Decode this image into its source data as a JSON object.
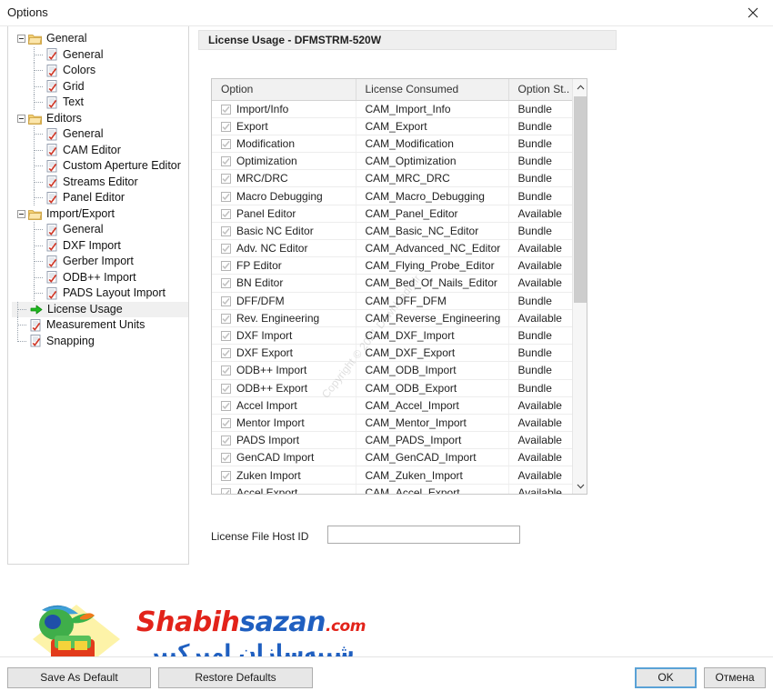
{
  "window": {
    "title": "Options",
    "close_icon": "close-icon",
    "close_glyph": "✕"
  },
  "tree": {
    "nodes": [
      {
        "label": "General",
        "level": 0,
        "icon": "folder-icon",
        "expanded": true,
        "selected": false
      },
      {
        "label": "General",
        "level": 1,
        "icon": "page-edit-icon",
        "expanded": false,
        "selected": false
      },
      {
        "label": "Colors",
        "level": 1,
        "icon": "page-edit-icon",
        "expanded": false,
        "selected": false
      },
      {
        "label": "Grid",
        "level": 1,
        "icon": "page-edit-icon",
        "expanded": false,
        "selected": false
      },
      {
        "label": "Text",
        "level": 1,
        "icon": "page-edit-icon",
        "expanded": false,
        "selected": false
      },
      {
        "label": "Editors",
        "level": 0,
        "icon": "folder-icon",
        "expanded": true,
        "selected": false
      },
      {
        "label": "General",
        "level": 1,
        "icon": "page-edit-icon",
        "expanded": false,
        "selected": false
      },
      {
        "label": "CAM Editor",
        "level": 1,
        "icon": "page-edit-icon",
        "expanded": false,
        "selected": false
      },
      {
        "label": "Custom Aperture Editor",
        "level": 1,
        "icon": "page-edit-icon",
        "expanded": false,
        "selected": false
      },
      {
        "label": "Streams Editor",
        "level": 1,
        "icon": "page-edit-icon",
        "expanded": false,
        "selected": false
      },
      {
        "label": "Panel Editor",
        "level": 1,
        "icon": "page-edit-icon",
        "expanded": false,
        "selected": false
      },
      {
        "label": "Import/Export",
        "level": 0,
        "icon": "folder-icon",
        "expanded": true,
        "selected": false
      },
      {
        "label": "General",
        "level": 1,
        "icon": "page-edit-icon",
        "expanded": false,
        "selected": false
      },
      {
        "label": "DXF Import",
        "level": 1,
        "icon": "page-edit-icon",
        "expanded": false,
        "selected": false
      },
      {
        "label": "Gerber Import",
        "level": 1,
        "icon": "page-edit-icon",
        "expanded": false,
        "selected": false
      },
      {
        "label": "ODB++ Import",
        "level": 1,
        "icon": "page-edit-icon",
        "expanded": false,
        "selected": false
      },
      {
        "label": "PADS Layout Import",
        "level": 1,
        "icon": "page-edit-icon",
        "expanded": false,
        "selected": false
      },
      {
        "label": "License Usage",
        "level": 0,
        "icon": "green-arrow-icon",
        "expanded": false,
        "selected": true
      },
      {
        "label": "Measurement Units",
        "level": 0,
        "icon": "page-edit-icon",
        "expanded": false,
        "selected": false
      },
      {
        "label": "Snapping",
        "level": 0,
        "icon": "page-edit-icon",
        "expanded": false,
        "selected": false
      }
    ]
  },
  "content": {
    "section_title": "License Usage - DFMSTRM-520W",
    "table": {
      "columns": [
        "Option",
        "License Consumed",
        "Option St.."
      ],
      "rows": [
        {
          "checked": true,
          "option": "Import/Info",
          "license": "CAM_Import_Info",
          "status": "Bundle"
        },
        {
          "checked": true,
          "option": "Export",
          "license": "CAM_Export",
          "status": "Bundle"
        },
        {
          "checked": true,
          "option": "Modification",
          "license": "CAM_Modification",
          "status": "Bundle"
        },
        {
          "checked": true,
          "option": "Optimization",
          "license": "CAM_Optimization",
          "status": "Bundle"
        },
        {
          "checked": true,
          "option": "MRC/DRC",
          "license": "CAM_MRC_DRC",
          "status": "Bundle"
        },
        {
          "checked": true,
          "option": "Macro Debugging",
          "license": "CAM_Macro_Debugging",
          "status": "Bundle"
        },
        {
          "checked": true,
          "option": "Panel Editor",
          "license": "CAM_Panel_Editor",
          "status": "Available"
        },
        {
          "checked": true,
          "option": "Basic NC Editor",
          "license": "CAM_Basic_NC_Editor",
          "status": "Bundle"
        },
        {
          "checked": true,
          "option": "Adv. NC Editor",
          "license": "CAM_Advanced_NC_Editor",
          "status": "Available"
        },
        {
          "checked": true,
          "option": "FP Editor",
          "license": "CAM_Flying_Probe_Editor",
          "status": "Available"
        },
        {
          "checked": true,
          "option": "BN Editor",
          "license": "CAM_Bed_Of_Nails_Editor",
          "status": "Available"
        },
        {
          "checked": true,
          "option": "DFF/DFM",
          "license": "CAM_DFF_DFM",
          "status": "Bundle"
        },
        {
          "checked": true,
          "option": "Rev. Engineering",
          "license": "CAM_Reverse_Engineering",
          "status": "Available"
        },
        {
          "checked": true,
          "option": "DXF Import",
          "license": "CAM_DXF_Import",
          "status": "Bundle"
        },
        {
          "checked": true,
          "option": "DXF Export",
          "license": "CAM_DXF_Export",
          "status": "Bundle"
        },
        {
          "checked": true,
          "option": "ODB++ Import",
          "license": "CAM_ODB_Import",
          "status": "Bundle"
        },
        {
          "checked": true,
          "option": "ODB++ Export",
          "license": "CAM_ODB_Export",
          "status": "Bundle"
        },
        {
          "checked": true,
          "option": "Accel Import",
          "license": "CAM_Accel_Import",
          "status": "Available"
        },
        {
          "checked": true,
          "option": "Mentor Import",
          "license": "CAM_Mentor_Import",
          "status": "Available"
        },
        {
          "checked": true,
          "option": "PADS Import",
          "license": "CAM_PADS_Import",
          "status": "Available"
        },
        {
          "checked": true,
          "option": "GenCAD Import",
          "license": "CAM_GenCAD_Import",
          "status": "Available"
        },
        {
          "checked": true,
          "option": "Zuken Import",
          "license": "CAM_Zuken_Import",
          "status": "Available"
        },
        {
          "checked": true,
          "option": "Accel Export",
          "license": "CAM_Accel_Export",
          "status": "Available"
        }
      ]
    },
    "host_id": {
      "label": "License File Host ID",
      "value": "",
      "placeholder": ""
    }
  },
  "watermark": {
    "brand_part1": "Shabih",
    "brand_part2": "sazan",
    "brand_suffix": ".com",
    "farsi": "شبیه‌سازان امیرکبیر",
    "badge_text": "Shabihsazan.com",
    "diagonal_text": "Copyright © 2021 Downloadly.ir"
  },
  "footer": {
    "save_as_default": "Save As Default",
    "restore_defaults": "Restore Defaults",
    "ok": "OK",
    "cancel": "Отмена"
  },
  "colors": {
    "accent": "#5aa2d6",
    "folder": "#f0c75e",
    "green_arrow": "#18b018",
    "brand_red": "#e2231a",
    "brand_blue": "#1f5fc0"
  }
}
